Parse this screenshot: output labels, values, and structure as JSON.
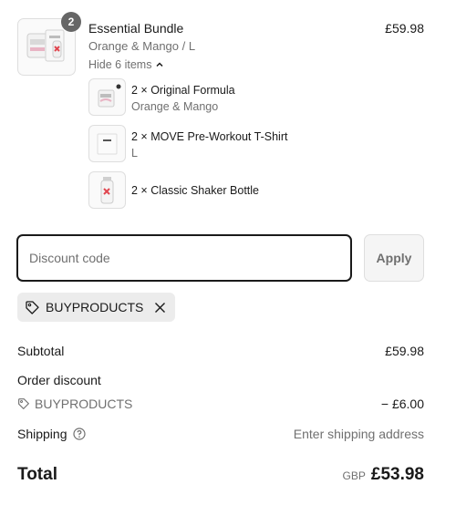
{
  "bundle": {
    "quantity_badge": "2",
    "title": "Essential Bundle",
    "price": "£59.98",
    "variant": "Orange & Mango / L",
    "hide_toggle_label": "Hide 6 items",
    "toggle_icon": "chevron-up-icon",
    "items": [
      {
        "title": "2 × Original Formula",
        "variant": "Orange & Mango",
        "icon": "supplement-tub-icon"
      },
      {
        "title": "2 × MOVE Pre-Workout T-Shirt",
        "variant": "L",
        "icon": "tshirt-icon"
      },
      {
        "title": "2 × Classic Shaker Bottle",
        "variant": "",
        "icon": "shaker-bottle-icon"
      }
    ]
  },
  "discount": {
    "placeholder": "Discount code",
    "apply_label": "Apply",
    "applied_code": "BUYPRODUCTS",
    "tag_icon": "tag-icon",
    "remove_icon": "close-icon"
  },
  "summary": {
    "subtotal_label": "Subtotal",
    "subtotal_value": "£59.98",
    "order_discount_label": "Order discount",
    "discount_code": "BUYPRODUCTS",
    "discount_value": "− £6.00",
    "shipping_label": "Shipping",
    "shipping_help_icon": "question-circle-icon",
    "shipping_value": "Enter shipping address",
    "total_label": "Total",
    "currency": "GBP",
    "total_value": "£53.98"
  },
  "colors": {
    "text": "#1a1a1a",
    "muted": "#707070",
    "border": "#dedede",
    "badge": "#666666",
    "chip": "#ececec",
    "accent_red": "#e0464f"
  }
}
